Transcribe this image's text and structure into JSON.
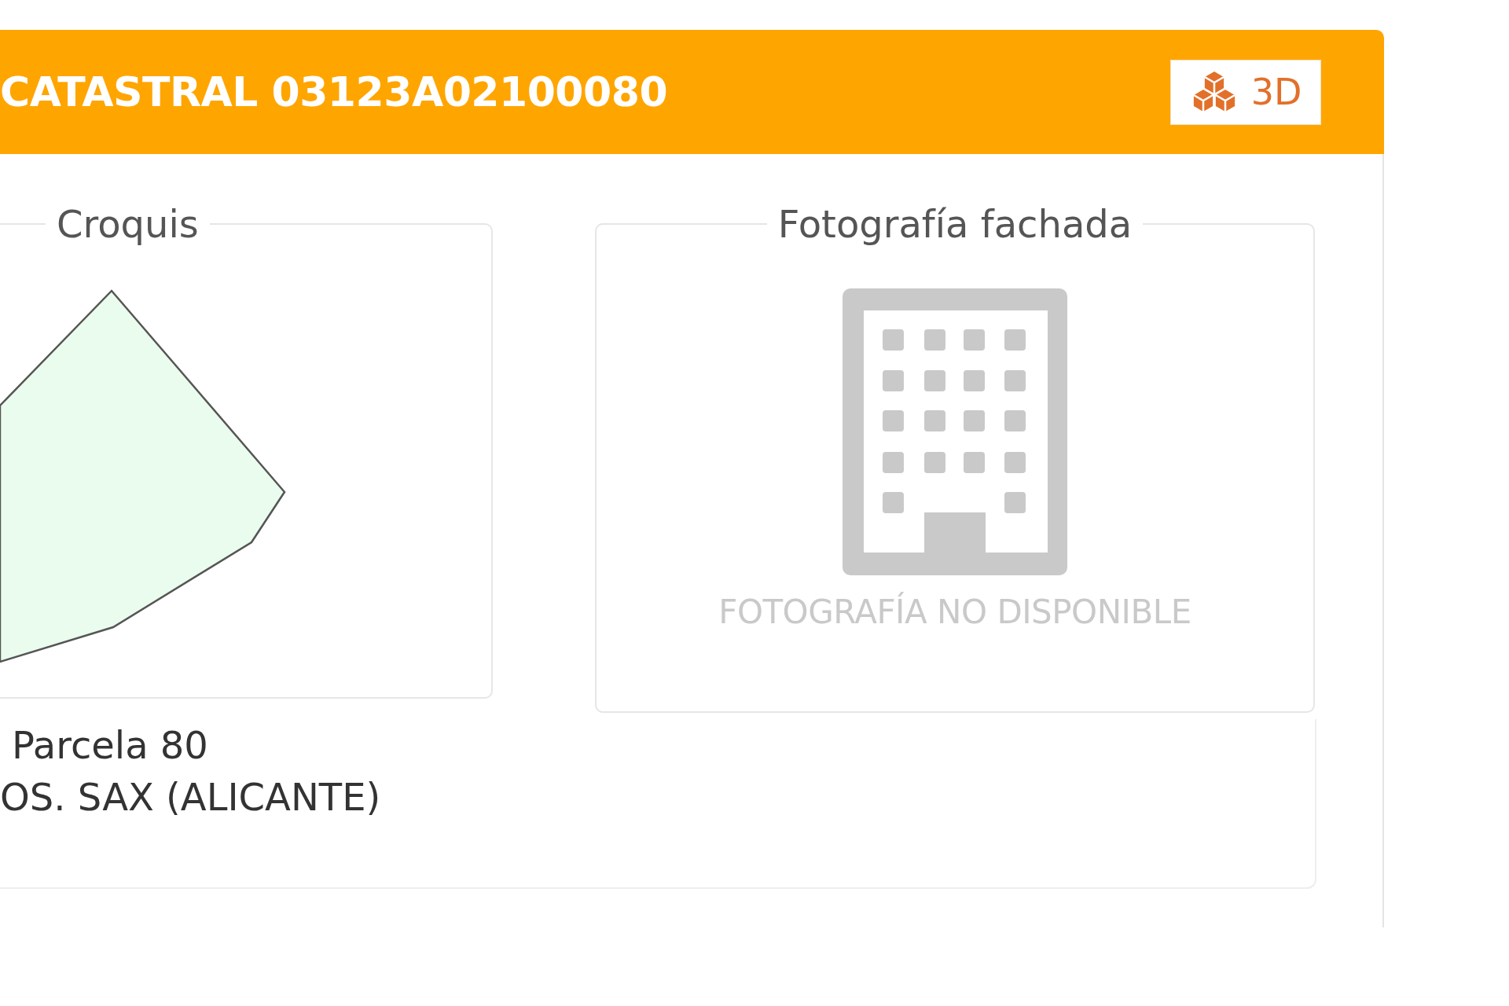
{
  "panel": {
    "title": "CATASTRAL 03123A02100080",
    "view_3d_button": {
      "label": "3D"
    },
    "sketch": {
      "legend": "Croquis"
    },
    "facade_photo": {
      "legend": "Fotografía fachada",
      "message": "FOTOGRAFÍA NO DISPONIBLE"
    },
    "location": {
      "lines": [
        "Parcela 80",
        "OS. SAX (ALICANTE)"
      ]
    }
  }
}
